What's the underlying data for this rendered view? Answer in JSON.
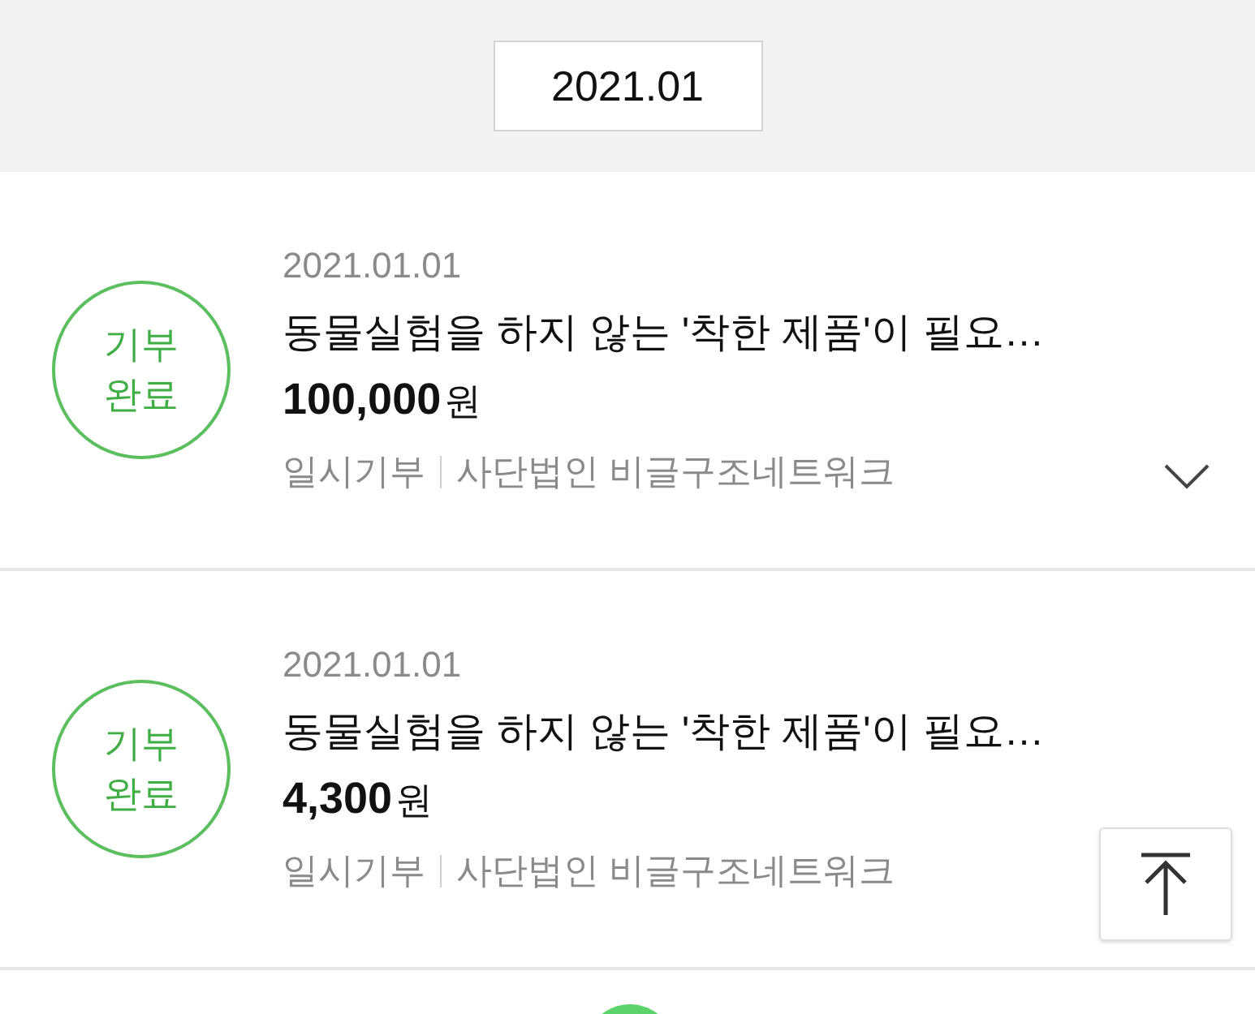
{
  "month": "2021.01",
  "donations": [
    {
      "status": "기부\n완료",
      "date": "2021.01.01",
      "title": "동물실험을 하지 않는 '착한 제품'이 필요…",
      "amount": "100,000",
      "unit": "원",
      "type": "일시기부",
      "org": "사단법인 비글구조네트워크",
      "chevron": true
    },
    {
      "status": "기부\n완료",
      "date": "2021.01.01",
      "title": "동물실험을 하지 않는 '착한 제품'이 필요…",
      "amount": "4,300",
      "unit": "원",
      "type": "일시기부",
      "org": "사단법인 비글구조네트워크",
      "chevron": false
    }
  ]
}
